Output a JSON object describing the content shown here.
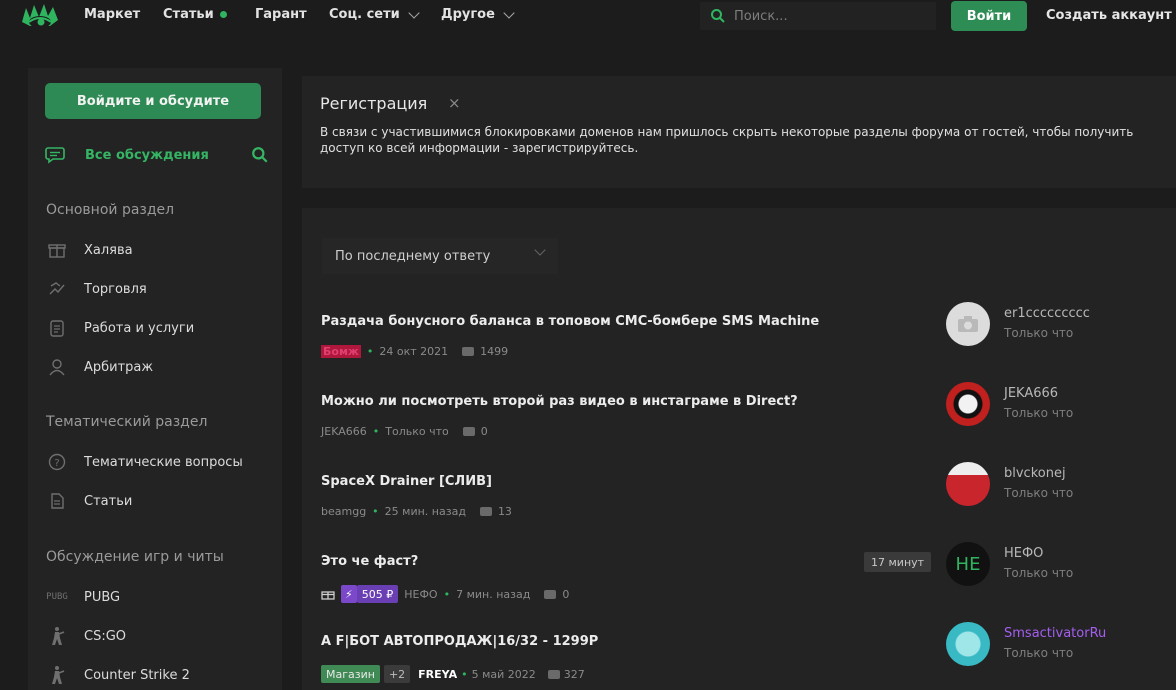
{
  "topbar": {
    "nav": [
      {
        "label": "Маркет"
      },
      {
        "label": "Статьи"
      },
      {
        "label": "Гарант"
      },
      {
        "label": "Соц. сети"
      },
      {
        "label": "Другое"
      }
    ],
    "search_placeholder": "Поиск...",
    "login_label": "Войти",
    "create_account_label": "Создать аккаунт"
  },
  "sidebar": {
    "discuss_button": "Войдите и обсудите",
    "all_discussions": "Все обсуждения",
    "sections": [
      {
        "title": "Основной раздел",
        "items": [
          {
            "label": "Халява",
            "icon": "gift-icon"
          },
          {
            "label": "Торговля",
            "icon": "handshake-icon"
          },
          {
            "label": "Работа и услуги",
            "icon": "clipboard-icon"
          },
          {
            "label": "Арбитраж",
            "icon": "user-icon"
          }
        ]
      },
      {
        "title": "Тематический раздел",
        "items": [
          {
            "label": "Тематические вопросы",
            "icon": "question-icon"
          },
          {
            "label": "Статьи",
            "icon": "document-icon"
          }
        ]
      },
      {
        "title": "Обсуждение игр и читы",
        "items": [
          {
            "label": "PUBG",
            "icon": "pubg-icon",
            "icon_text": "PUBG"
          },
          {
            "label": "CS:GO",
            "icon": "soldier-icon"
          },
          {
            "label": "Counter Strike 2",
            "icon": "soldier-icon"
          }
        ]
      }
    ]
  },
  "notice": {
    "title": "Регистрация",
    "close": "×",
    "text": "В связи с участившимися блокировками доменов нам пришлось скрыть некоторые разделы форума от гостей, чтобы получить доступ ко всей информации - зарегистрируйтесь."
  },
  "sort": {
    "label": "По последнему ответу"
  },
  "threads": [
    {
      "title": "Раздача бонусного баланса в топовом СМС-бомбере SMS Machine",
      "author": "Бомж",
      "date": "24 окт 2021",
      "replies": "1499",
      "last_user": "er1ccccccccc",
      "last_time": "Только что"
    },
    {
      "title": "Можно ли посмотреть второй раз видео в инстаграме в Direct?",
      "author": "JEKA666",
      "date": "Только что",
      "replies": "0",
      "last_user": "JEKA666",
      "last_time": "Только что"
    },
    {
      "title": "SpaceX Drainer [СЛИВ]",
      "author": "beamgg",
      "date": "25 мин. назад",
      "replies": "13",
      "last_user": "blvckonej",
      "last_time": "Только что"
    },
    {
      "title": "Это че фаст?",
      "badge": "17 минут",
      "prize": "505 ₽",
      "author": "НЕФО",
      "date": "7 мин. назад",
      "replies": "0",
      "last_user": "НЕФО",
      "last_time": "Только что",
      "avatar_text": "НЕ"
    },
    {
      "title": "A F|БОТ АВТОПРОДАЖ|16/32 - 1299Р",
      "tags": [
        "Магазин",
        "+2"
      ],
      "author": "FREYA",
      "date": "5 май 2022",
      "replies": "327",
      "last_user": "SmsactivatorRu",
      "last_time": "Только что"
    }
  ],
  "colors": {
    "accent": "#2e8c55",
    "green": "#2fb55f",
    "background": "#1c1c1c",
    "panel": "#232323"
  }
}
